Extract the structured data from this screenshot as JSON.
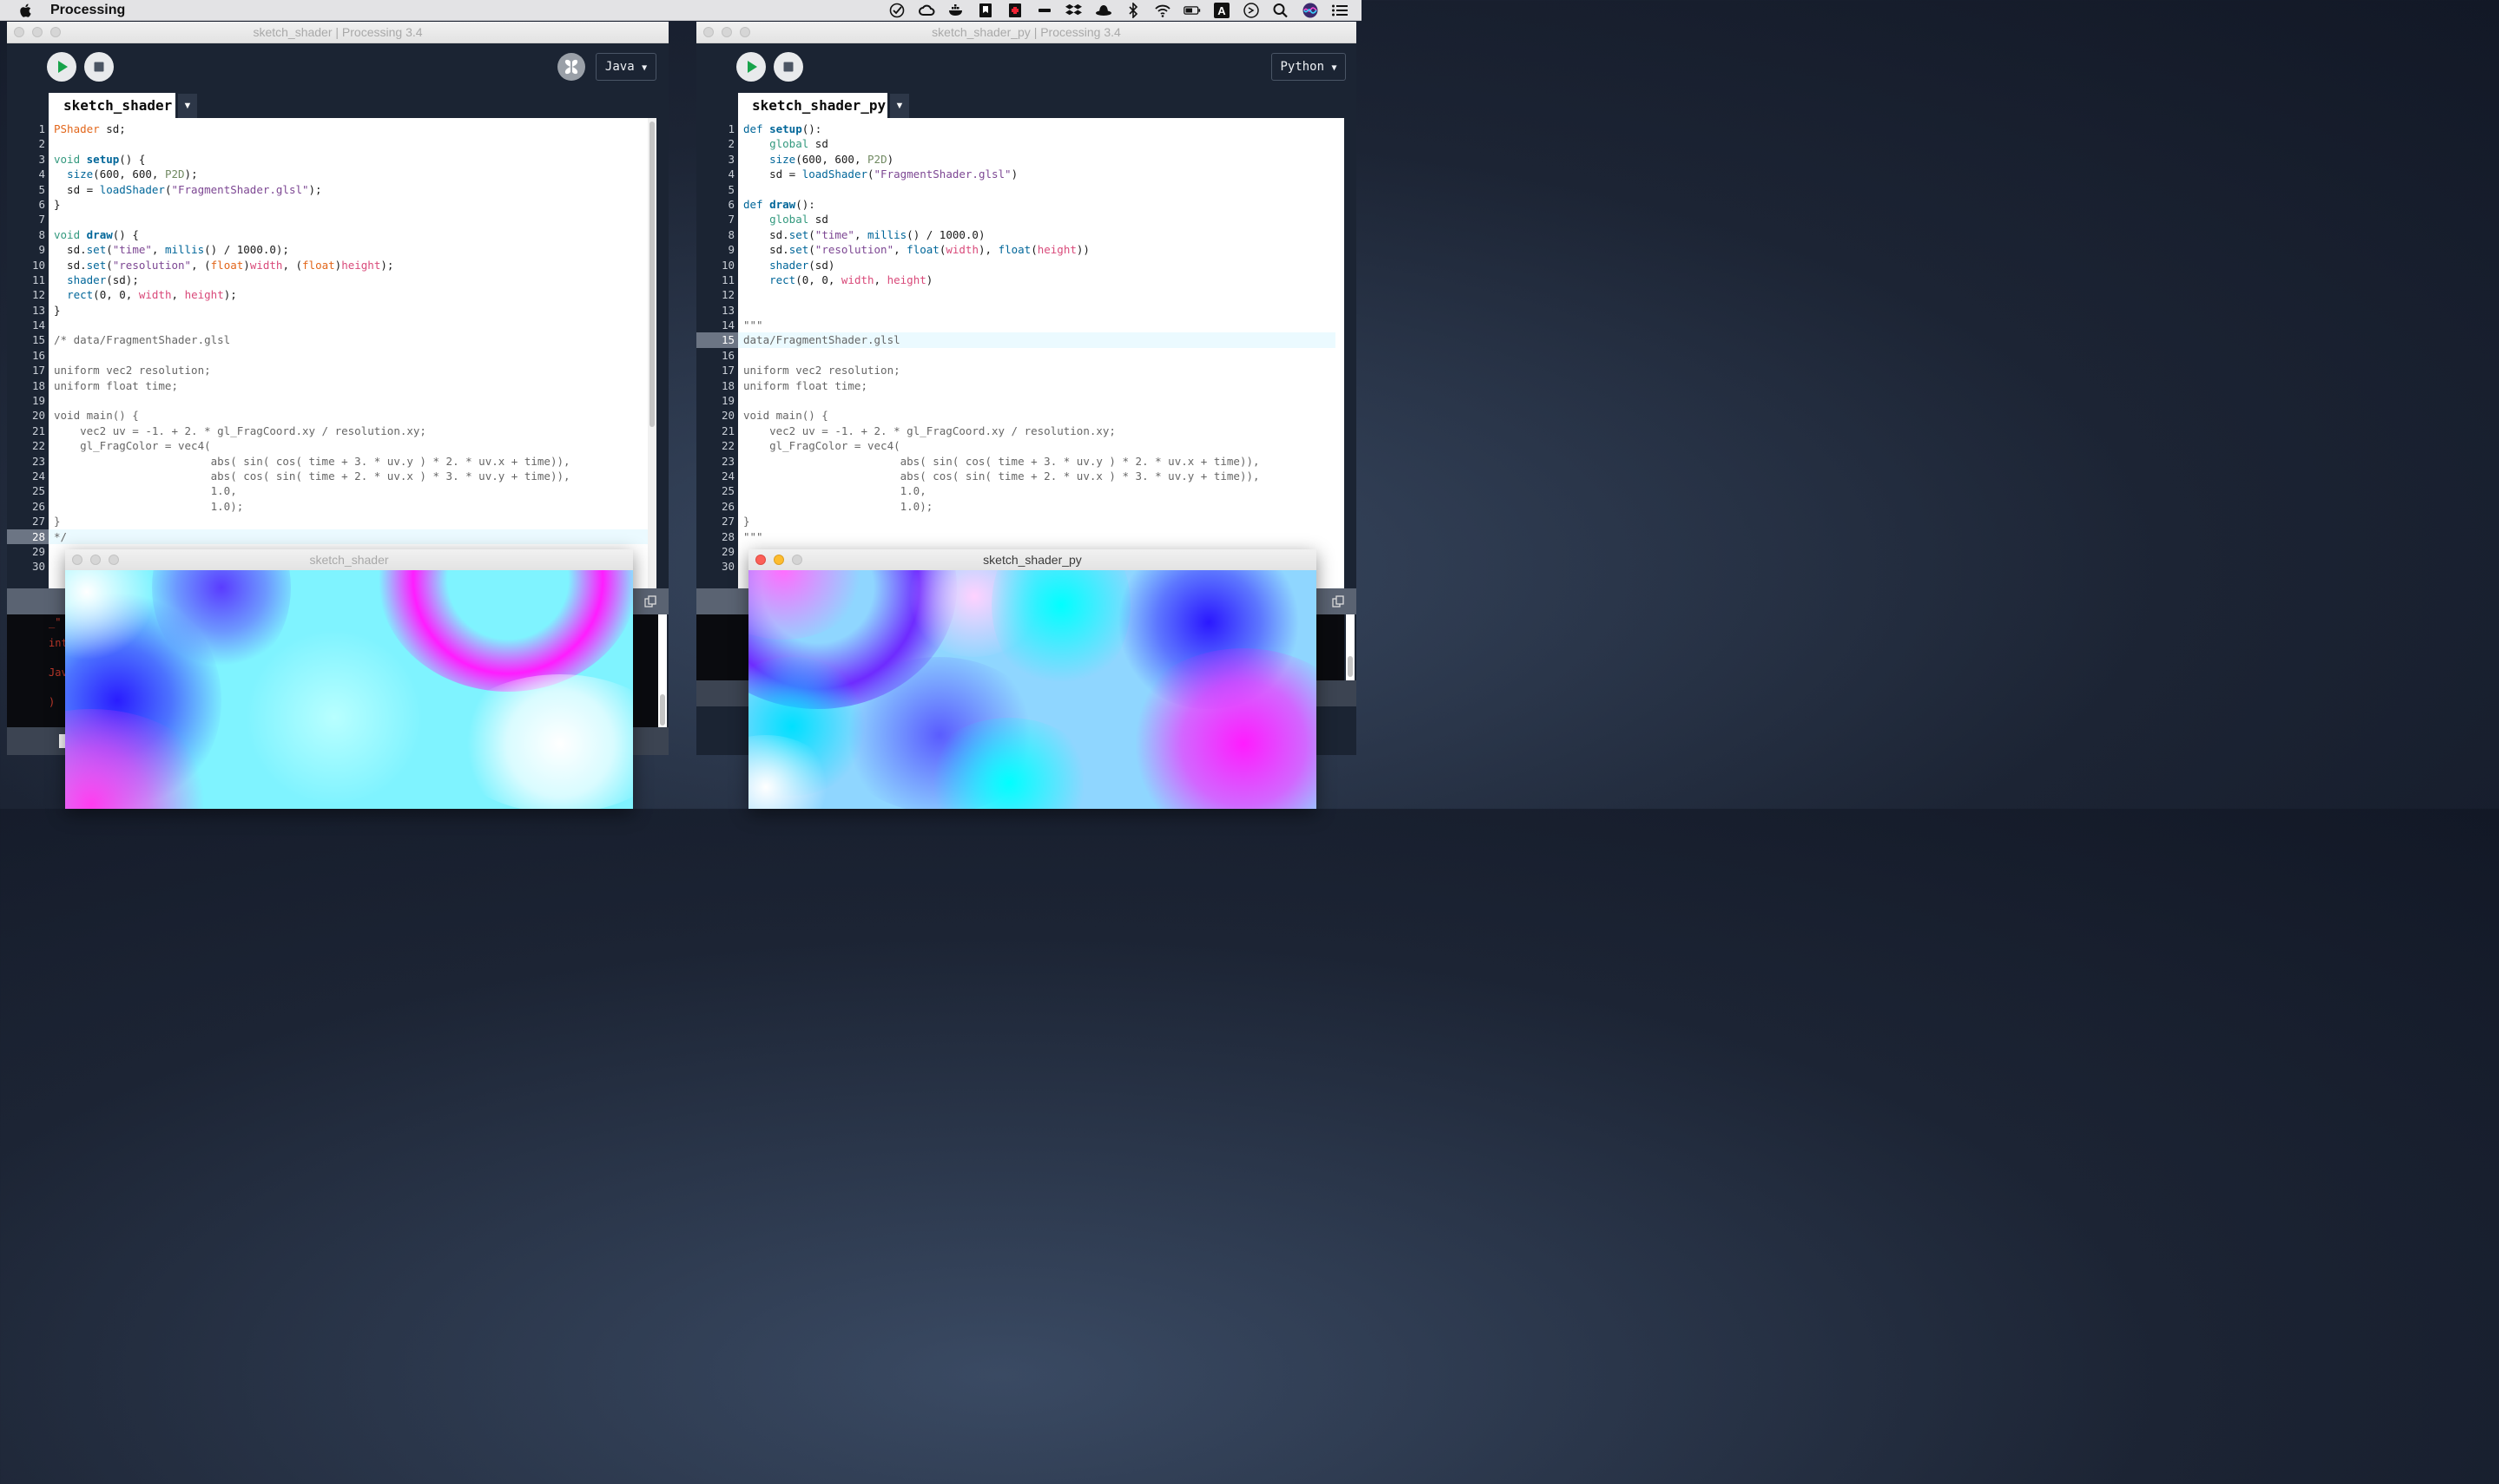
{
  "menubar": {
    "app_name": "Processing",
    "tray_icons": [
      "checkmark-icon",
      "creative-cloud-icon",
      "docker-icon",
      "bookmark-icon",
      "antivirus-icon",
      "minus-icon",
      "dropbox-icon",
      "hat-icon",
      "bluetooth-icon",
      "wifi-icon",
      "battery-icon",
      "input-source-icon",
      "gauge-icon",
      "search-icon",
      "siri-icon",
      "list-icon"
    ],
    "input_letter": "A"
  },
  "java": {
    "window_title": "sketch_shader | Processing 3.4",
    "mode": "Java",
    "tab": "sketch_shader",
    "lines": [
      "PShader sd;",
      "",
      "void setup() {",
      "  size(600, 600, P2D);",
      "  sd = loadShader(\"FragmentShader.glsl\");",
      "}",
      "",
      "void draw() {",
      "  sd.set(\"time\", millis() / 1000.0);",
      "  sd.set(\"resolution\", (float)width, (float)height);",
      "  shader(sd);",
      "  rect(0, 0, width, height);",
      "}",
      "",
      "/* data/FragmentShader.glsl",
      "",
      "uniform vec2 resolution;",
      "uniform float time;",
      "",
      "void main() {",
      "    vec2 uv = -1. + 2. * gl_FragCoord.xy / resolution.xy;",
      "    gl_FragColor = vec4(",
      "                        abs( sin( cos( time + 3. * uv.y ) * 2. * uv.x + time)),",
      "                        abs( cos( sin( time + 2. * uv.x ) * 3. * uv.y + time)),",
      "                        1.0,",
      "                        1.0);",
      "}",
      "*/",
      "",
      ""
    ],
    "console_lines": [
      "_\"",
      "int",
      "Jav",
      ")"
    ],
    "output_title": "sketch_shader"
  },
  "python": {
    "window_title": "sketch_shader_py | Processing 3.4",
    "mode": "Python",
    "tab": "sketch_shader_py",
    "lines": [
      "def setup():",
      "    global sd",
      "    size(600, 600, P2D)",
      "    sd = loadShader(\"FragmentShader.glsl\")",
      "",
      "def draw():",
      "    global sd",
      "    sd.set(\"time\", millis() / 1000.0)",
      "    sd.set(\"resolution\", float(width), float(height))",
      "    shader(sd)",
      "    rect(0, 0, width, height)",
      "",
      "",
      "\"\"\"",
      "data/FragmentShader.glsl",
      "",
      "uniform vec2 resolution;",
      "uniform float time;",
      "",
      "void main() {",
      "    vec2 uv = -1. + 2. * gl_FragCoord.xy / resolution.xy;",
      "    gl_FragColor = vec4(",
      "                        abs( sin( cos( time + 3. * uv.y ) * 2. * uv.x + time)),",
      "                        abs( cos( sin( time + 2. * uv.x ) * 3. * uv.y + time)),",
      "                        1.0,",
      "                        1.0);",
      "}",
      "\"\"\"",
      "",
      ""
    ],
    "output_title": "sketch_shader_py"
  },
  "colors": {
    "editor_bg": "#1b2433",
    "current_line": "#ebfaff",
    "run_button_green": "#17a34a",
    "close_red": "#fc5f57",
    "minimize_yellow": "#fdbc2e"
  }
}
